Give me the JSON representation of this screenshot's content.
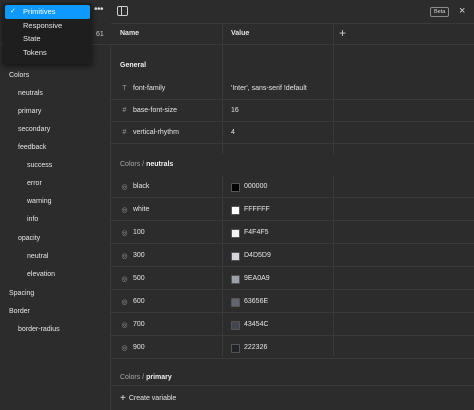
{
  "dropdown": {
    "items": [
      {
        "label": "Primitives",
        "selected": true
      },
      {
        "label": "Responsive",
        "selected": false
      },
      {
        "label": "State",
        "selected": false
      },
      {
        "label": "Tokens",
        "selected": false
      }
    ]
  },
  "sidebar": {
    "count": "61",
    "tree": [
      {
        "label": "Colors"
      },
      {
        "label": "neutrals"
      },
      {
        "label": "primary"
      },
      {
        "label": "secondary"
      },
      {
        "label": "feedback"
      },
      {
        "label": "success"
      },
      {
        "label": "error"
      },
      {
        "label": "warning"
      },
      {
        "label": "info"
      },
      {
        "label": "opacity"
      },
      {
        "label": "neutral"
      },
      {
        "label": "elevation"
      },
      {
        "label": "Spacing"
      },
      {
        "label": "Border"
      },
      {
        "label": "border-radius"
      }
    ]
  },
  "toolbar": {
    "beta": "Beta",
    "close": "×"
  },
  "table": {
    "col_name": "Name",
    "col_value": "Value",
    "add": "+"
  },
  "groups": {
    "general": {
      "title": "General"
    },
    "neutrals": {
      "path": "Colors / ",
      "name": "neutrals"
    },
    "primary": {
      "path": "Colors / ",
      "name": "primary"
    }
  },
  "general_rows": [
    {
      "icon": "T",
      "name": "font-family",
      "value": "'Inter', sans-serif !default"
    },
    {
      "icon": "#",
      "name": "base-font-size",
      "value": "16"
    },
    {
      "icon": "#",
      "name": "vertical-rhythm",
      "value": "4"
    }
  ],
  "color_rows": [
    {
      "name": "black",
      "value": "000000",
      "color": "#000000"
    },
    {
      "name": "white",
      "value": "FFFFFF",
      "color": "#FFFFFF"
    },
    {
      "name": "100",
      "value": "F4F4F5",
      "color": "#F4F4F5"
    },
    {
      "name": "300",
      "value": "D4D5D9",
      "color": "#D4D5D9"
    },
    {
      "name": "500",
      "value": "9EA0A9",
      "color": "#9EA0A9"
    },
    {
      "name": "600",
      "value": "63656E",
      "color": "#63656E"
    },
    {
      "name": "700",
      "value": "43454C",
      "color": "#43454C"
    },
    {
      "name": "900",
      "value": "222326",
      "color": "#222326"
    }
  ],
  "create": {
    "label": "Create variable"
  }
}
